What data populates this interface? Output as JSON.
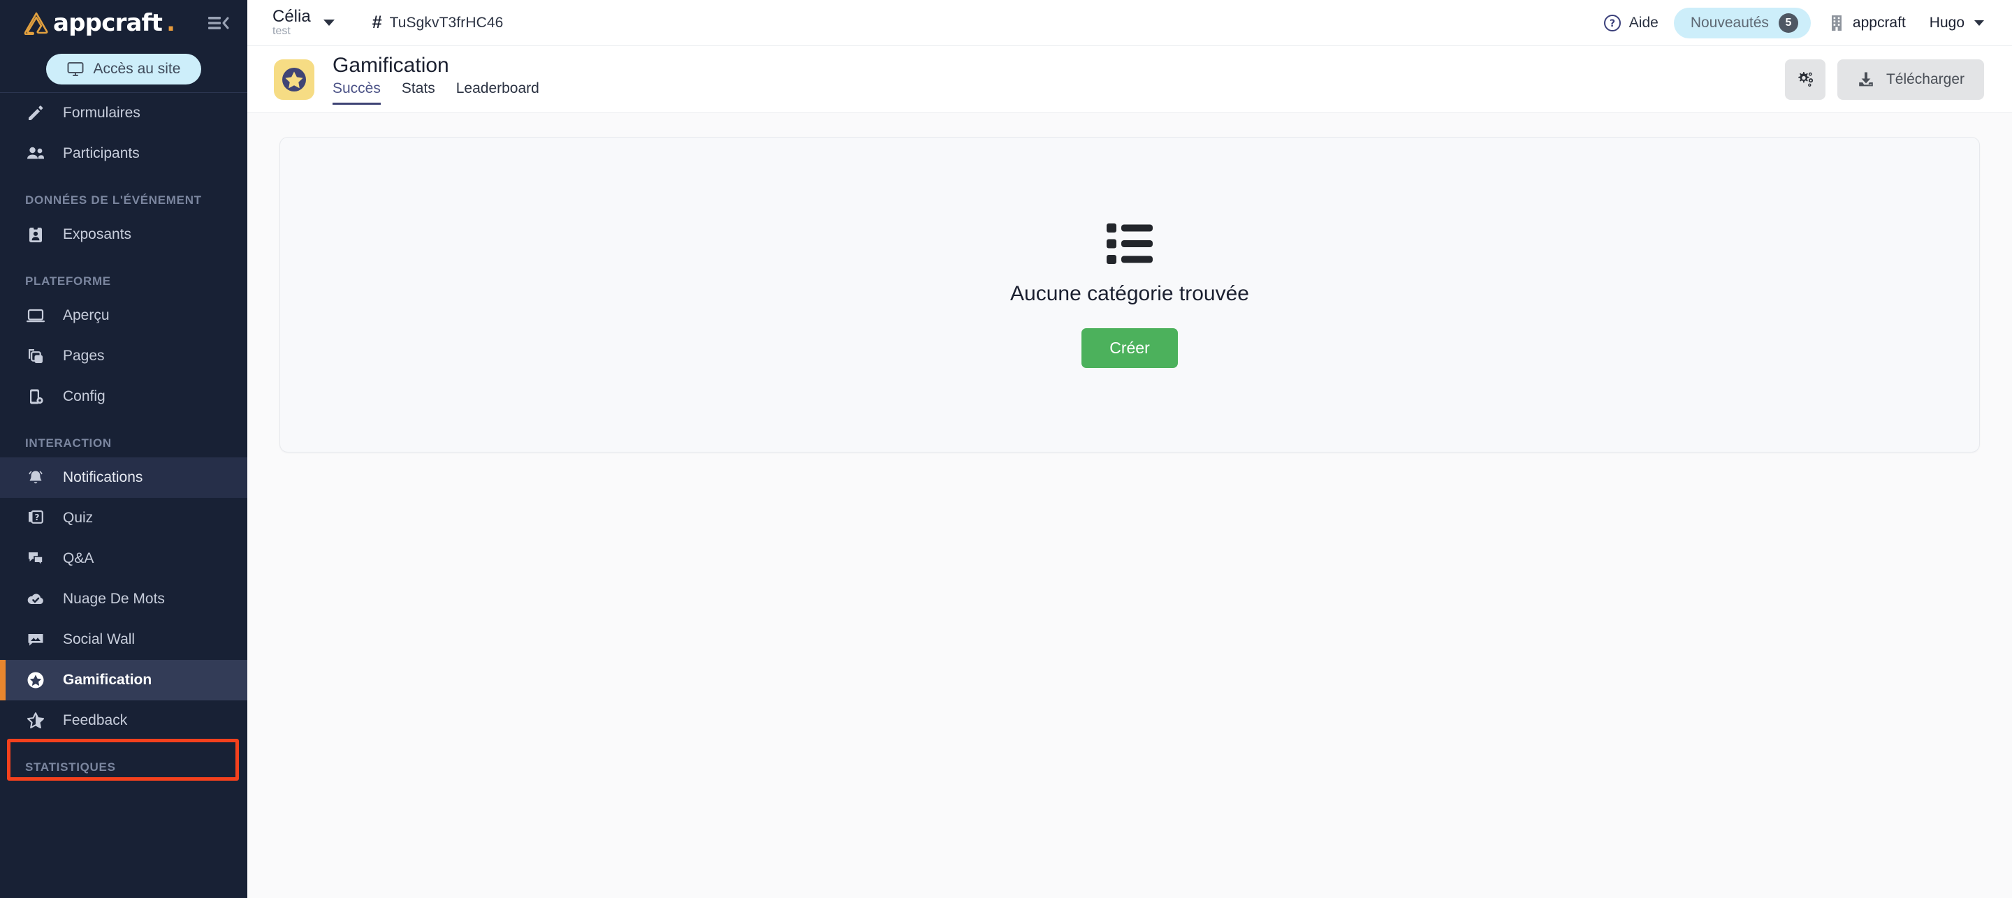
{
  "colors": {
    "sidebar_bg": "#182135",
    "sidebar_active_bg": "#333c57",
    "accent_orange": "#e8862e",
    "annotation_red": "#f4411d",
    "brand_logo_gold": "#e79b3c",
    "pill_blue": "#cdeefa",
    "tab_active": "#3f4475",
    "create_green": "#4cb15c",
    "page_icon_yellow": "#f6dc84"
  },
  "sidebar": {
    "brand": {
      "name": "appcraft",
      "dot": ".",
      "logo_icon": "appcraft-triangle-logo"
    },
    "collapse_icon": "collapse-sidebar-icon",
    "access_button": {
      "label": "Accès au site",
      "icon": "monitor-icon"
    },
    "groups": [
      {
        "label": null,
        "items": [
          {
            "label": "Formulaires",
            "icon": "pencil-icon",
            "state": "normal"
          },
          {
            "label": "Participants",
            "icon": "users-icon",
            "state": "normal"
          }
        ]
      },
      {
        "label": "DONNÉES DE L'ÉVÉNEMENT",
        "items": [
          {
            "label": "Exposants",
            "icon": "exhibitor-badge-icon",
            "state": "normal"
          }
        ]
      },
      {
        "label": "PLATEFORME",
        "items": [
          {
            "label": "Aperçu",
            "icon": "laptop-icon",
            "state": "normal"
          },
          {
            "label": "Pages",
            "icon": "pages-stack-icon",
            "state": "normal"
          },
          {
            "label": "Config",
            "icon": "device-settings-icon",
            "state": "normal"
          }
        ]
      },
      {
        "label": "INTERACTION",
        "items": [
          {
            "label": "Notifications",
            "icon": "bell-icon",
            "state": "hovered"
          },
          {
            "label": "Quiz",
            "icon": "quiz-card-icon",
            "state": "normal"
          },
          {
            "label": "Q&A",
            "icon": "chat-bubbles-icon",
            "state": "normal"
          },
          {
            "label": "Nuage De Mots",
            "icon": "cloud-check-icon",
            "state": "normal"
          },
          {
            "label": "Social Wall",
            "icon": "image-bubble-icon",
            "state": "normal"
          },
          {
            "label": "Gamification",
            "icon": "star-circle-icon",
            "state": "active"
          },
          {
            "label": "Feedback",
            "icon": "star-outline-icon",
            "state": "normal"
          }
        ]
      },
      {
        "label": "STATISTIQUES",
        "items": []
      }
    ]
  },
  "topbar": {
    "event": {
      "name": "Célia",
      "subtitle": "test",
      "caret_icon": "chevron-down-icon"
    },
    "event_code": {
      "hash": "#",
      "code": "TuSgkvT3frHC46"
    },
    "help": {
      "label": "Aide",
      "icon": "question-circle-icon"
    },
    "news": {
      "label": "Nouveautés",
      "count": "5"
    },
    "organization": {
      "label": "appcraft",
      "icon": "building-icon"
    },
    "user": {
      "label": "Hugo",
      "caret_icon": "chevron-down-icon"
    }
  },
  "pagehead": {
    "icon": "gamification-star-icon",
    "title": "Gamification",
    "tabs": [
      {
        "label": "Succès",
        "active": true
      },
      {
        "label": "Stats",
        "active": false
      },
      {
        "label": "Leaderboard",
        "active": false
      }
    ],
    "settings_button": {
      "icon": "gears-icon",
      "label": ""
    },
    "download_button": {
      "label": "Télécharger",
      "icon": "download-icon"
    }
  },
  "content": {
    "empty_state": {
      "icon": "list-icon",
      "message": "Aucune catégorie trouvée",
      "create_button": "Créer"
    }
  }
}
